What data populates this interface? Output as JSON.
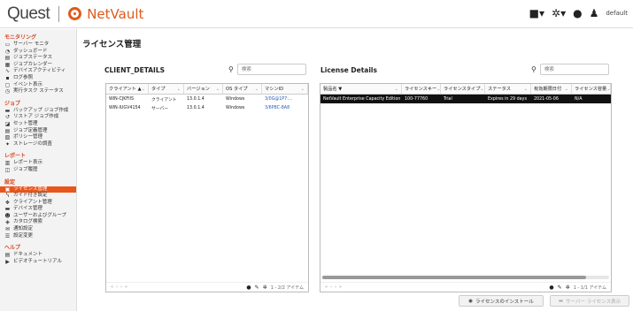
{
  "header": {
    "brand": "Quest",
    "product": "NetVault",
    "user": "default"
  },
  "sidebar": {
    "sections": [
      {
        "title": "モニタリング",
        "items": [
          {
            "icon": "monitor-icon",
            "glyph": "▭",
            "label": "サーバー モニタ"
          },
          {
            "icon": "dashboard-icon",
            "glyph": "◔",
            "label": "ダッシュボード"
          },
          {
            "icon": "job-status-icon",
            "glyph": "▤",
            "label": "ジョブステータス"
          },
          {
            "icon": "calendar-icon",
            "glyph": "▦",
            "label": "ジョブカレンダー"
          },
          {
            "icon": "activity-icon",
            "glyph": "∿",
            "label": "デバイスアクティビティ"
          },
          {
            "icon": "log-icon",
            "glyph": "▪",
            "label": "ログ参照"
          },
          {
            "icon": "event-icon",
            "glyph": "▢",
            "label": "イベント表示"
          },
          {
            "icon": "task-icon",
            "glyph": "◷",
            "label": "実行タスク ステータス"
          }
        ]
      },
      {
        "title": "ジョブ",
        "items": [
          {
            "icon": "backup-icon",
            "glyph": "▬",
            "label": "バックアップ ジョブ作成"
          },
          {
            "icon": "restore-icon",
            "glyph": "↺",
            "label": "リストア ジョブ作成"
          },
          {
            "icon": "set-icon",
            "glyph": "◪",
            "label": "セット管理"
          },
          {
            "icon": "job-def-icon",
            "glyph": "▤",
            "label": "ジョブ定義管理"
          },
          {
            "icon": "policy-icon",
            "glyph": "▧",
            "label": "ポリシー管理"
          },
          {
            "icon": "storage-icon",
            "glyph": "✦",
            "label": "ストレージの調査"
          }
        ]
      },
      {
        "title": "レポート",
        "items": [
          {
            "icon": "report-icon",
            "glyph": "▥",
            "label": "レポート表示"
          },
          {
            "icon": "job-history-icon",
            "glyph": "◫",
            "label": "ジョブ履歴"
          }
        ]
      },
      {
        "title": "設定",
        "items": [
          {
            "icon": "license-icon",
            "glyph": "▣",
            "label": "ライセンス管理",
            "active": true
          },
          {
            "icon": "wizard-icon",
            "glyph": "ᓭ",
            "label": "ガイド付き設定"
          },
          {
            "icon": "client-icon",
            "glyph": "❖",
            "label": "クライアント管理"
          },
          {
            "icon": "device-icon",
            "glyph": "▬",
            "label": "デバイス管理"
          },
          {
            "icon": "users-icon",
            "glyph": "☻",
            "label": "ユーザーおよびグループ"
          },
          {
            "icon": "catalog-icon",
            "glyph": "◈",
            "label": "カタログ検索"
          },
          {
            "icon": "notification-icon",
            "glyph": "✉",
            "label": "通知設定"
          },
          {
            "icon": "settings-icon",
            "glyph": "☰",
            "label": "設定変更"
          }
        ]
      },
      {
        "title": "ヘルプ",
        "items": [
          {
            "icon": "document-icon",
            "glyph": "▤",
            "label": "ドキュメント"
          },
          {
            "icon": "tutorial-icon",
            "glyph": "▶",
            "label": "ビデオチュートリアル"
          }
        ]
      }
    ]
  },
  "page": {
    "title": "ライセンス管理"
  },
  "client_details": {
    "title": "CLIENT_DETAILS",
    "search_placeholder": "検索",
    "columns": [
      "クライアント ▲",
      "タイプ",
      "バージョン",
      "OS タイプ",
      "マシンID"
    ],
    "rows": [
      [
        "WIN-CJKFIIS",
        "クライアント",
        "13.0.1.4",
        "Windows",
        "3/0G@1P7:..."
      ],
      [
        "WIN-IUGV4154",
        "サーバー",
        "13.0.1.4",
        "Windows",
        "3/6P8C-8A8"
      ]
    ],
    "footer_count": "1 - 2/2 アイテム"
  },
  "license_details": {
    "title": "License Details",
    "search_placeholder": "検索",
    "columns": [
      "製品名 ▼",
      "ライセンスキー",
      "ライセンスタイプ",
      "ステータス",
      "有効期限日付",
      "ライセンス容量"
    ],
    "rows": [
      [
        "NetVault Enterprise Capacity Edition",
        "100-77760",
        "Trial",
        "Expires in 29 days",
        "2021-05-06",
        "N/A"
      ]
    ],
    "footer_count": "1 - 1/1 アイテム"
  },
  "actions": {
    "install_label": "ライセンスのインストール",
    "server_license_label": "サーバー ライセンス表示"
  },
  "colors": {
    "accent": "#e8561c",
    "section": "#d9421a"
  }
}
